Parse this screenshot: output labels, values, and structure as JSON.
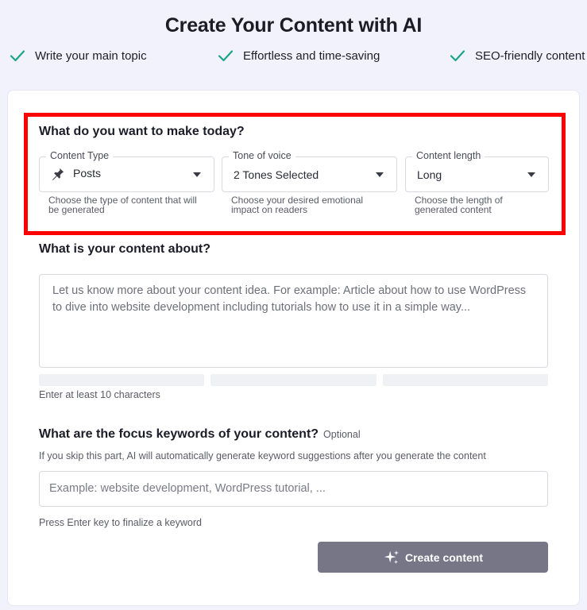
{
  "header": {
    "title": "Create Your Content with AI",
    "features": [
      "Write your main topic",
      "Effortless and time-saving",
      "SEO-friendly content"
    ],
    "check_color": "#1aa58a"
  },
  "settings": {
    "title": "What do you want to make today?",
    "content_type": {
      "label": "Content Type",
      "value": "Posts",
      "icon": "pin-icon",
      "helper": "Choose the type of content that will be generated"
    },
    "tone": {
      "label": "Tone of voice",
      "value": "2 Tones Selected",
      "helper": "Choose your desired emotional impact on readers"
    },
    "length": {
      "label": "Content length",
      "value": "Long",
      "helper": "Choose the length of generated content"
    }
  },
  "about": {
    "title": "What is your content about?",
    "placeholder": "Let us know more about your content idea. For example: Article about how to use WordPress to dive into website development including tutorials how to use it in a simple way...",
    "hint": "Enter at least 10 characters"
  },
  "keywords": {
    "title": "What are the focus keywords of your content?",
    "optional": "Optional",
    "description": "If you skip this part, AI will automatically generate keyword suggestions after you generate the content",
    "placeholder": "Example: website development, WordPress tutorial, ...",
    "hint": "Press Enter key to finalize a keyword"
  },
  "actions": {
    "create_label": "Create content",
    "button_color": "#767687"
  },
  "highlight_color": "#ff0000"
}
